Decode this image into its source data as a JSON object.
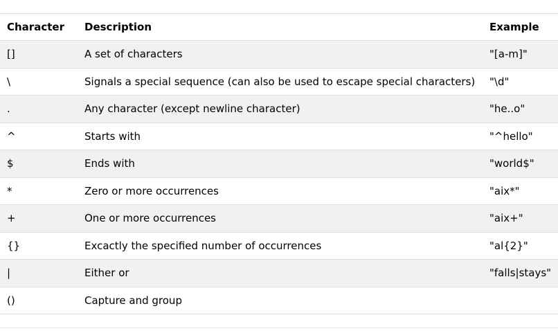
{
  "table": {
    "headers": {
      "character": "Character",
      "description": "Description",
      "example": "Example"
    },
    "rows": [
      {
        "character": "[]",
        "description": "A set of characters",
        "example": "\"[a-m]\""
      },
      {
        "character": "\\",
        "description": "Signals a special sequence (can also be used to escape special characters)",
        "example": "\"\\d\""
      },
      {
        "character": ".",
        "description": "Any character (except newline character)",
        "example": "\"he..o\""
      },
      {
        "character": "^",
        "description": "Starts with",
        "example": "\"^hello\""
      },
      {
        "character": "$",
        "description": "Ends with",
        "example": "\"world$\""
      },
      {
        "character": "*",
        "description": "Zero or more occurrences",
        "example": "\"aix*\""
      },
      {
        "character": "+",
        "description": "One or more occurrences",
        "example": "\"aix+\""
      },
      {
        "character": "{}",
        "description": "Excactly the specified number of occurrences",
        "example": "\"al{2}\""
      },
      {
        "character": "|",
        "description": "Either or",
        "example": "\"falls|stays\""
      },
      {
        "character": "()",
        "description": "Capture and group",
        "example": ""
      }
    ]
  },
  "colors": {
    "stripe": "#f1f1f1",
    "border": "#dddddd"
  }
}
